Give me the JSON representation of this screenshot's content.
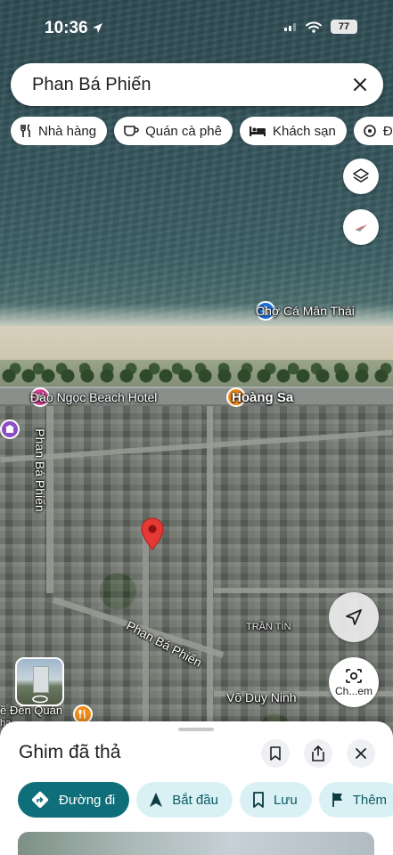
{
  "status_bar": {
    "time": "10:36",
    "battery": "77"
  },
  "search": {
    "query": "Phan Bá Phiến"
  },
  "chips": [
    {
      "icon": "restaurant-icon",
      "label": "Nhà hàng"
    },
    {
      "icon": "coffee-icon",
      "label": "Quán cà phê"
    },
    {
      "icon": "hotel-icon",
      "label": "Khách sạn"
    },
    {
      "icon": "attraction-icon",
      "label": "Địa đ"
    }
  ],
  "map": {
    "poi_market": "Chợ Cá Mân Thái",
    "poi_hotel": "Đảo Ngọc Beach Hotel",
    "road_hoang_sa": "Hoàng Sa",
    "road_phan_ba_phien_vertical": "Phan Bá Phiến",
    "road_phan_ba_phien_diag": "Phan Bá Phiến",
    "road_vo_duy_ninh": "Võ Duy Ninh",
    "poi_tran_tin": "TRẦN TÍN",
    "poi_bottom_left": "ề Đến Quán",
    "poi_bottom_left_sub": "ha"
  },
  "lens": {
    "label": "Ch...em"
  },
  "sheet": {
    "title": "Ghim đã thả",
    "actions": [
      {
        "icon": "directions-icon",
        "label": "Đường đi",
        "primary": true
      },
      {
        "icon": "navigation-arrow-icon",
        "label": "Bắt đầu"
      },
      {
        "icon": "bookmark-icon",
        "label": "Lưu"
      },
      {
        "icon": "flag-icon",
        "label": "Thêm"
      }
    ]
  },
  "colors": {
    "primary": "#0e6f7a",
    "chip_tint": "#d9f1f5",
    "pin": "#e53935"
  }
}
